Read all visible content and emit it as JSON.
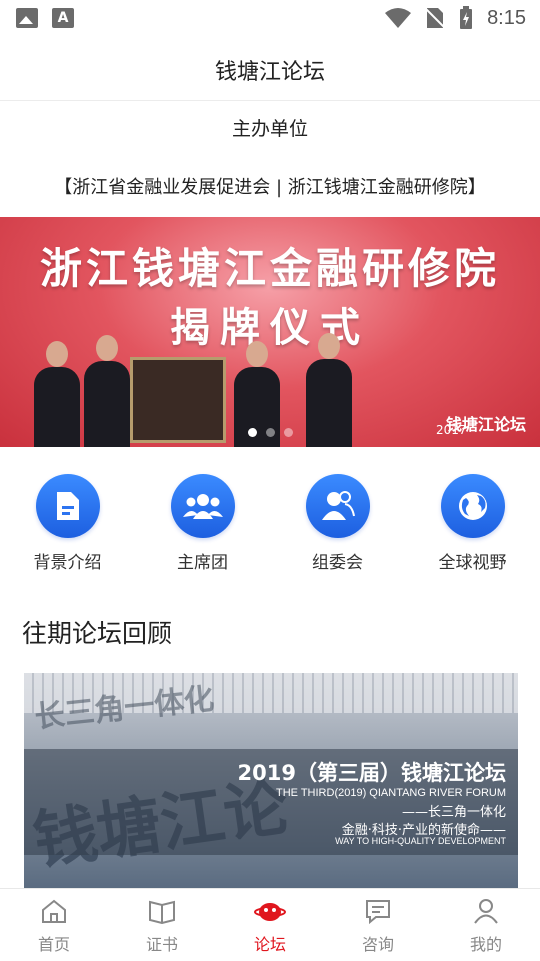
{
  "status_bar": {
    "time": "8:15"
  },
  "header": {
    "title": "钱塘江论坛"
  },
  "organizer": {
    "heading": "主办单位",
    "names": "【浙江省金融业发展促进会 | 浙江钱塘江金融研修院】"
  },
  "banner": {
    "line1": "浙江钱塘江金融研修院",
    "line2": "揭牌仪式",
    "brand": "钱塘江论坛",
    "year": "2017",
    "slide_count": 3,
    "active_slide": 1
  },
  "quick_links": [
    {
      "label": "背景介绍",
      "icon": "document-icon"
    },
    {
      "label": "主席团",
      "icon": "group-icon"
    },
    {
      "label": "组委会",
      "icon": "committee-icon"
    },
    {
      "label": "全球视野",
      "icon": "globe-icon"
    }
  ],
  "review": {
    "section_title": "往期论坛回顾",
    "bg_text": "长三角一体化",
    "bg_brush": "钱塘江论",
    "title": "2019（第三届）钱塘江论坛",
    "en_title": "THE THIRD(2019) QIANTANG RIVER FORUM",
    "sub1": "——长三角一体化",
    "sub2": "金融·科技·产业的新使命——",
    "en_sub": "WAY TO HIGH-QUALITY DEVELOPMENT"
  },
  "tabs": [
    {
      "label": "首页",
      "icon": "home-icon"
    },
    {
      "label": "证书",
      "icon": "book-icon"
    },
    {
      "label": "论坛",
      "icon": "forum-icon",
      "active": true
    },
    {
      "label": "咨询",
      "icon": "message-icon"
    },
    {
      "label": "我的",
      "icon": "person-icon"
    }
  ],
  "colors": {
    "accent_red": "#e0161e",
    "icon_blue": "#2c74f0"
  }
}
